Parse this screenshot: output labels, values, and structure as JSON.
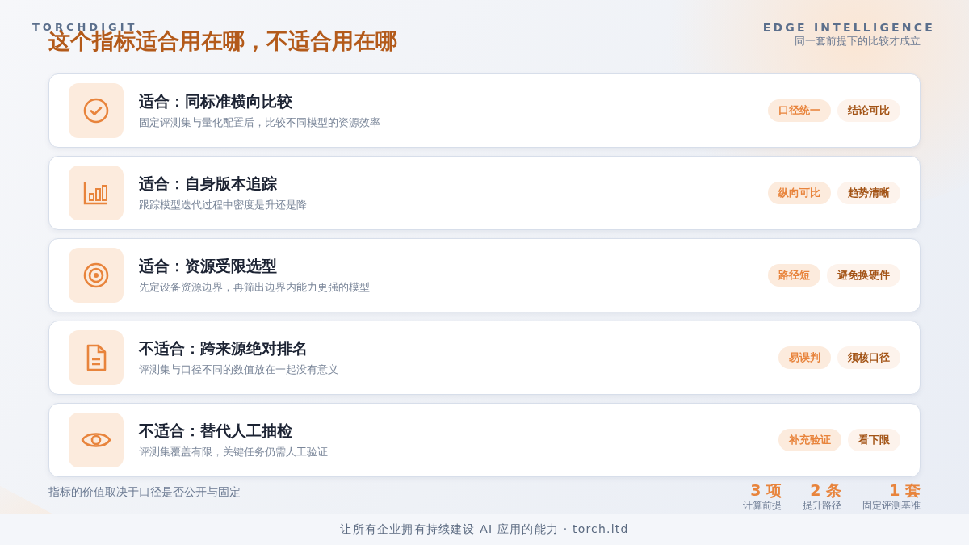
{
  "brand": "TORCHDIGIT",
  "title": "这个指标适合用在哪，不适合用在哪",
  "header_right": {
    "eyebrow": "EDGE INTELLIGENCE",
    "subtitle": "同一套前提下的比较才成立"
  },
  "cards": [
    {
      "kind": "check",
      "title": "适合：同标准横向比较",
      "description": "固定评测集与量化配置后，比较不同模型的资源效率",
      "tags": [
        {
          "label": "口径统一",
          "kind": "primary"
        },
        {
          "label": "结论可比",
          "kind": "secondary"
        }
      ]
    },
    {
      "kind": "bars",
      "title": "适合：自身版本追踪",
      "description": "跟踪模型迭代过程中密度是升还是降",
      "tags": [
        {
          "label": "纵向可比",
          "kind": "primary"
        },
        {
          "label": "趋势清晰",
          "kind": "secondary"
        }
      ]
    },
    {
      "kind": "target",
      "title": "适合：资源受限选型",
      "description": "先定设备资源边界，再筛出边界内能力更强的模型",
      "tags": [
        {
          "label": "路径短",
          "kind": "primary"
        },
        {
          "label": "避免换硬件",
          "kind": "secondary"
        }
      ]
    },
    {
      "kind": "document",
      "title": "不适合：跨来源绝对排名",
      "description": "评测集与口径不同的数值放在一起没有意义",
      "tags": [
        {
          "label": "易误判",
          "kind": "primary"
        },
        {
          "label": "须核口径",
          "kind": "secondary"
        }
      ]
    },
    {
      "kind": "eye",
      "title": "不适合：替代人工抽检",
      "description": "评测集覆盖有限，关键任务仍需人工验证",
      "tags": [
        {
          "label": "补充验证",
          "kind": "primary"
        },
        {
          "label": "看下限",
          "kind": "secondary"
        }
      ]
    }
  ],
  "note": "指标的价值取决于口径是否公开与固定",
  "stats": [
    {
      "value": "3 项",
      "label": "计算前提"
    },
    {
      "value": "2 条",
      "label": "提升路径"
    },
    {
      "value": "1 套",
      "label": "固定评测基准"
    }
  ],
  "footer": "让所有企业拥有持续建设 AI 应用的能力 · torch.ltd"
}
